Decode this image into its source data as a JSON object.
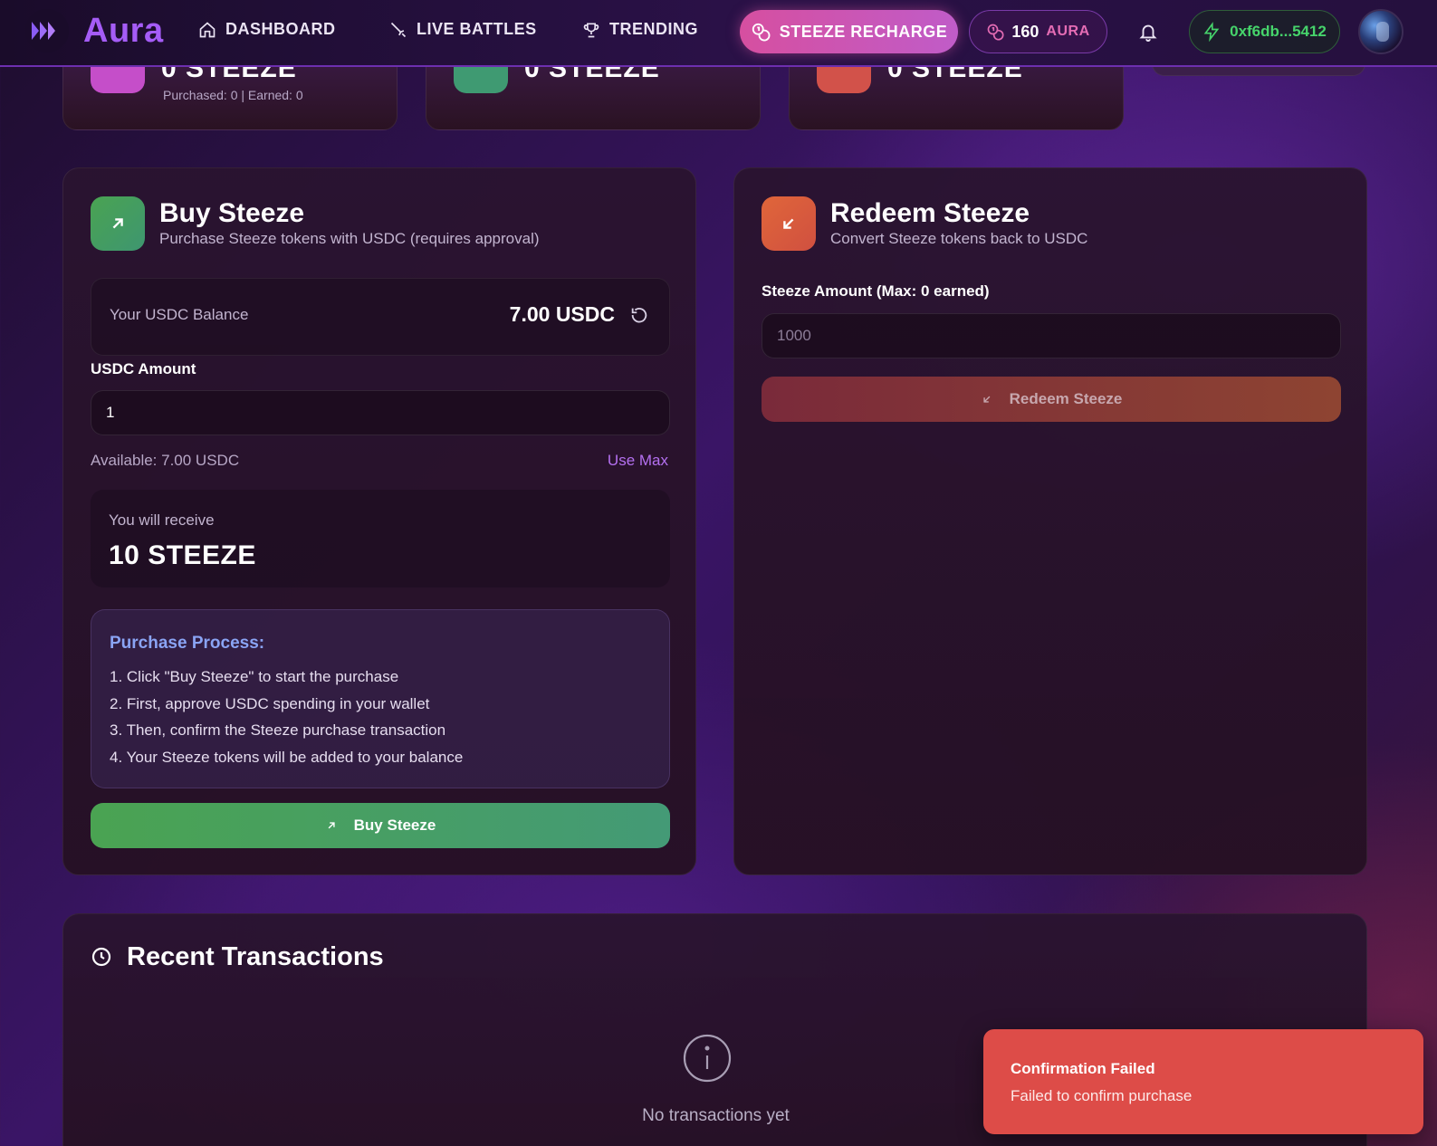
{
  "app": {
    "name": "Aura"
  },
  "nav": {
    "items": [
      {
        "label": "DASHBOARD",
        "icon": "home-icon"
      },
      {
        "label": "LIVE BATTLES",
        "icon": "sword-icon"
      },
      {
        "label": "TRENDING",
        "icon": "trophy-icon"
      }
    ],
    "recharge_label": "STEEZE RECHARGE",
    "aura_count": "160",
    "aura_unit": "AURA",
    "wallet": "0xf6db...5412"
  },
  "stats": [
    {
      "value": "0 STEEZE",
      "sub": "Purchased: 0 | Earned: 0",
      "color": "#c54ec9"
    },
    {
      "value": "0 STEEZE",
      "sub": "",
      "color": "#3f9a72"
    },
    {
      "value": "0 STEEZE",
      "sub": "",
      "color": "#d2524a"
    }
  ],
  "buy": {
    "title": "Buy Steeze",
    "subtitle": "Purchase Steeze tokens with USDC (requires approval)",
    "balance_label": "Your USDC Balance",
    "balance_value": "7.00 USDC",
    "amount_label": "USDC Amount",
    "amount_value": "1",
    "available": "Available: 7.00 USDC",
    "use_max": "Use Max",
    "receive_label": "You will receive",
    "receive_value": "10 STEEZE",
    "process_title": "Purchase Process:",
    "steps": [
      "1. Click \"Buy Steeze\" to start the purchase",
      "2. First, approve USDC spending in your wallet",
      "3. Then, confirm the Steeze purchase transaction",
      "4. Your Steeze tokens will be added to your balance"
    ],
    "button_label": "Buy Steeze"
  },
  "redeem": {
    "title": "Redeem Steeze",
    "subtitle": "Convert Steeze tokens back to USDC",
    "amount_label": "Steeze Amount (Max: 0 earned)",
    "amount_placeholder": "1000",
    "button_label": "Redeem Steeze"
  },
  "transactions": {
    "title": "Recent Transactions",
    "empty_text": "No transactions yet"
  },
  "toast": {
    "title": "Confirmation Failed",
    "message": "Failed to confirm purchase"
  },
  "colors": {
    "accent_purple": "#a55cf7",
    "buy_green": "#4aa352",
    "redeem_orange": "#e0663a",
    "toast_red": "#dd4c48",
    "wallet_green": "#46d46b"
  }
}
